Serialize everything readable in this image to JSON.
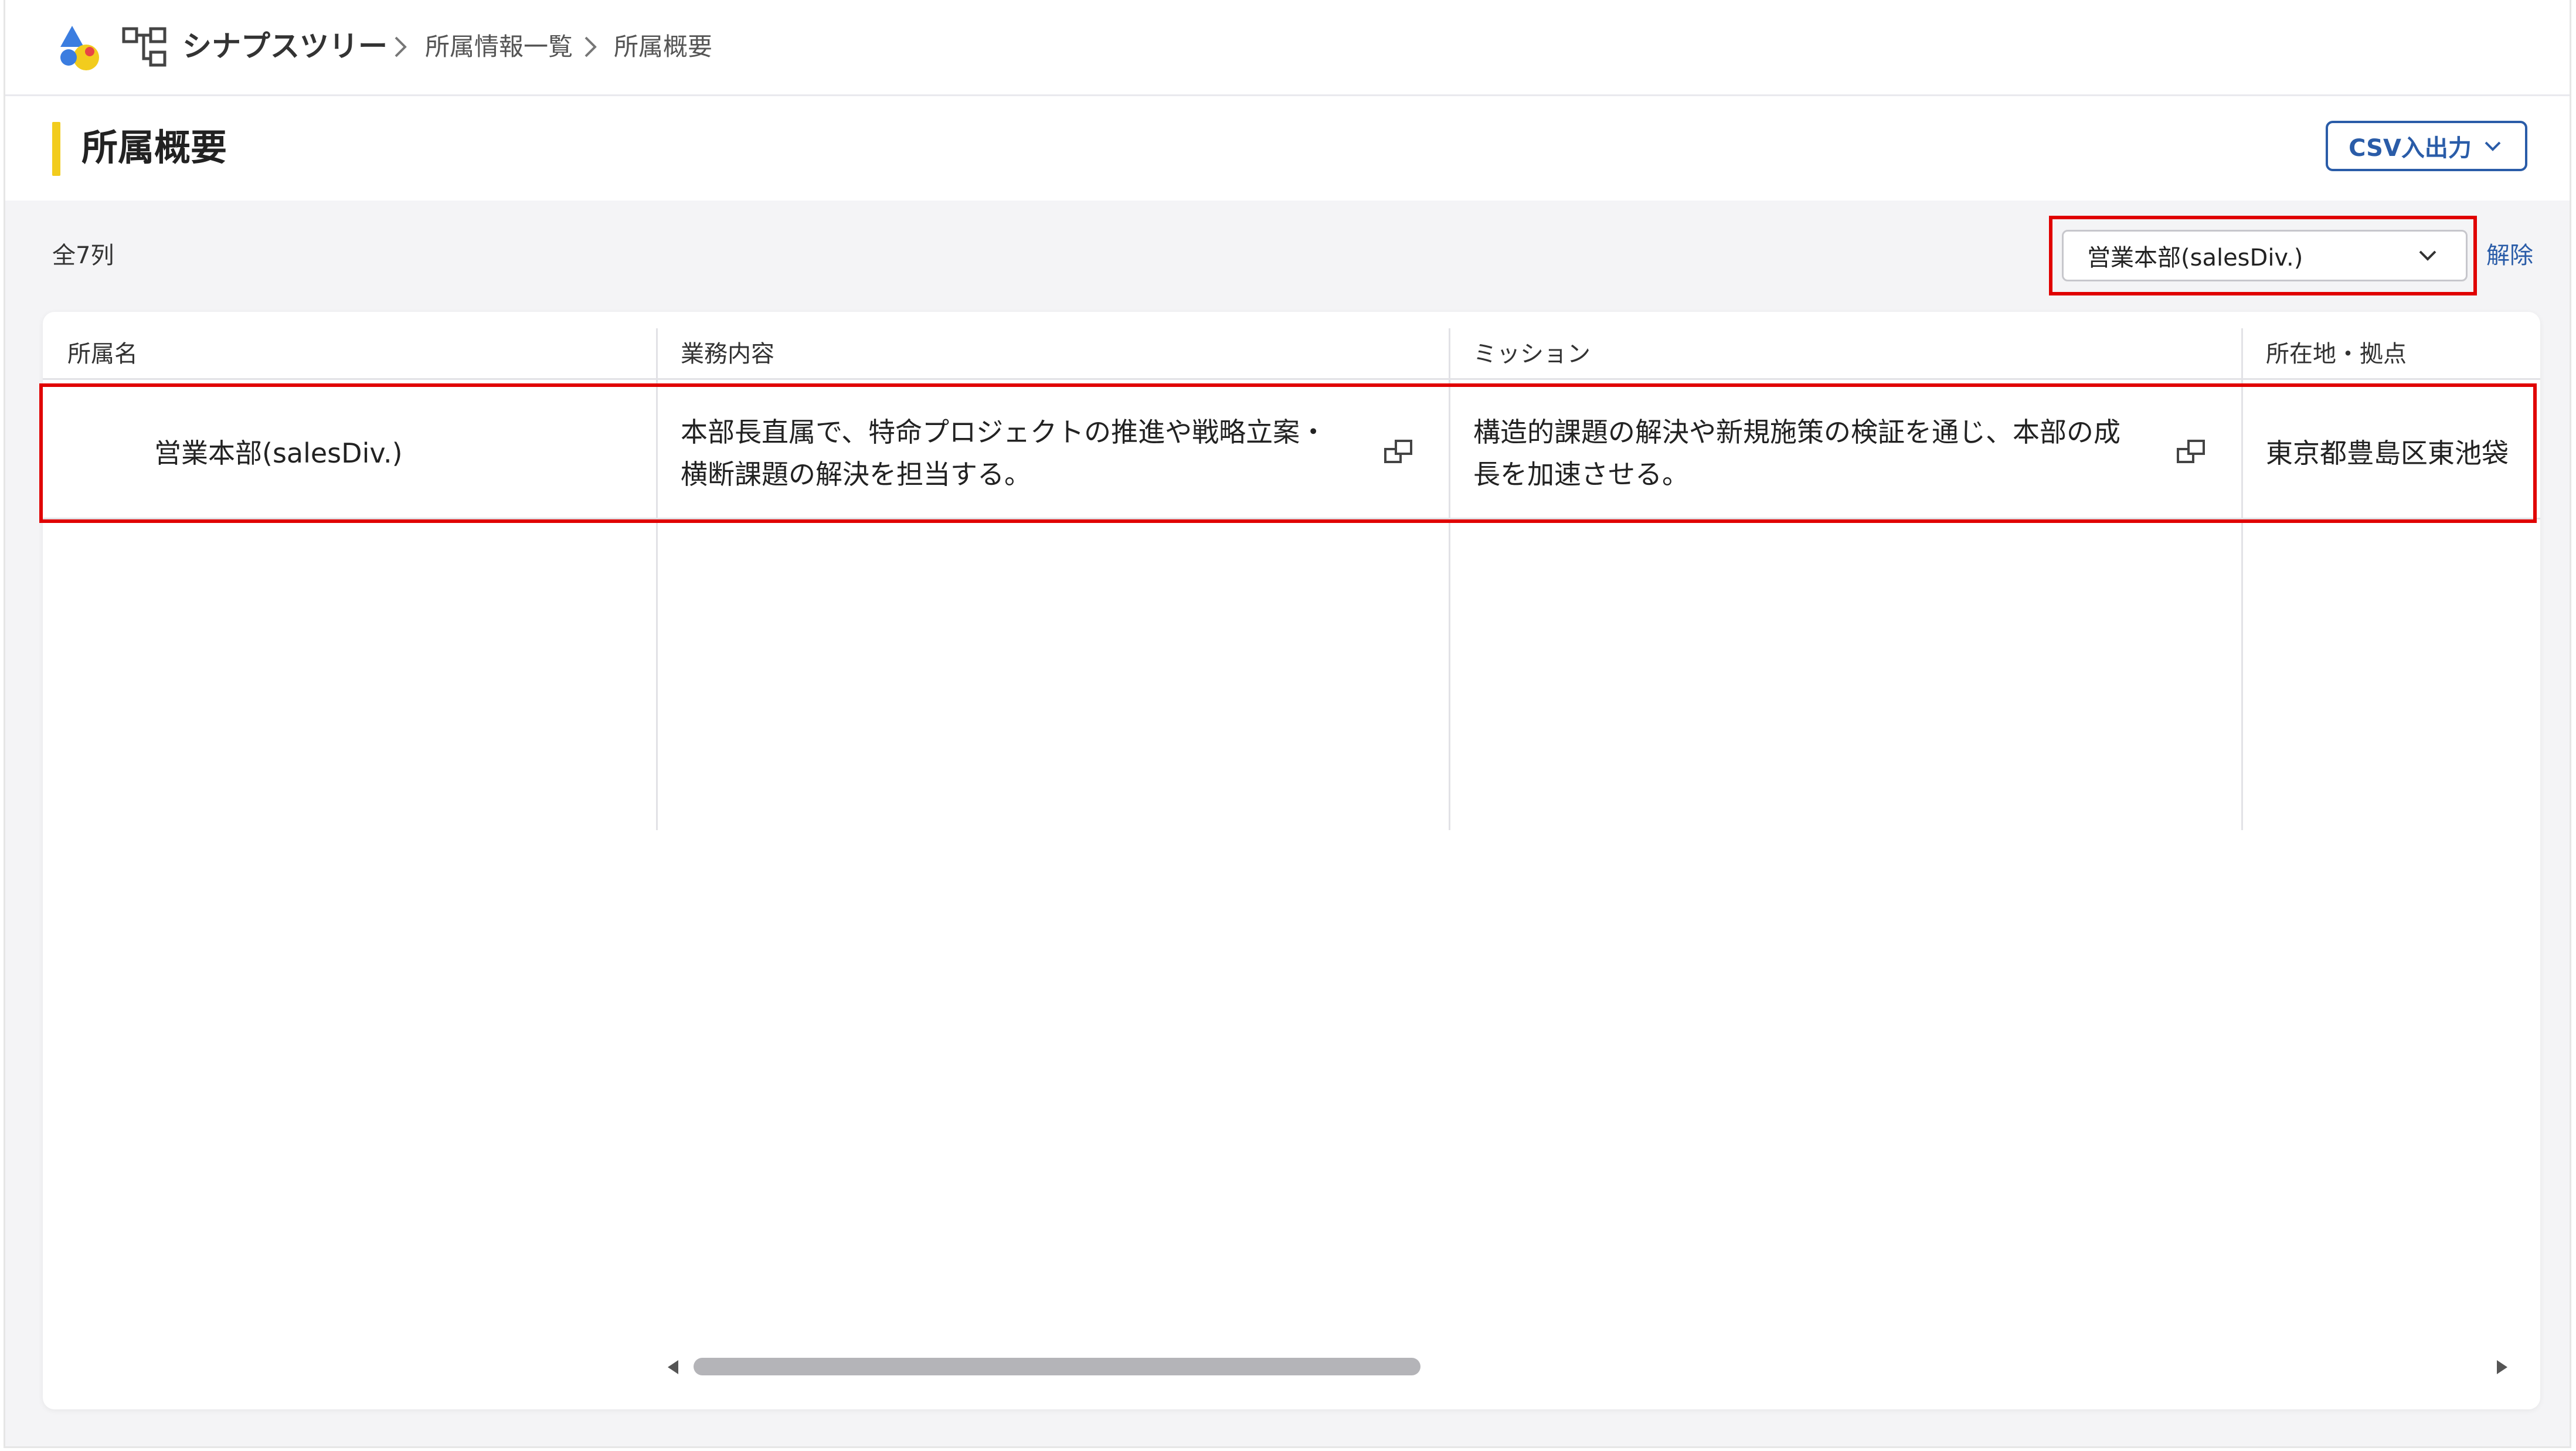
{
  "nav": {
    "app_name": "シナプスツリー",
    "breadcrumbs": [
      "所属情報一覧",
      "所属概要"
    ],
    "logo_colors": [
      "#3b7de0",
      "#f2cc1d",
      "#e84545"
    ]
  },
  "header": {
    "title": "所属概要",
    "accent_color": "#f2cc1d",
    "csv_button_label": "CSV入出力"
  },
  "filter": {
    "count_label": "全7列",
    "selected_value": "営業本部(salesDiv.)",
    "clear_label": "解除"
  },
  "table": {
    "columns": [
      "所属名",
      "業務内容",
      "ミッション",
      "所在地・拠点"
    ],
    "rows": [
      {
        "name": "営業本部(salesDiv.)",
        "business": "本部長直属で、特命プロジェクトの推進や戦略立案・横断課題の解決を担当する。",
        "mission": "構造的課題の解決や新規施策の検証を通じ、本部の成長を加速させる。",
        "location": "東京都豊島区東池袋"
      }
    ]
  },
  "colors": {
    "highlight": "#e00000",
    "link": "#2a5ca8"
  }
}
